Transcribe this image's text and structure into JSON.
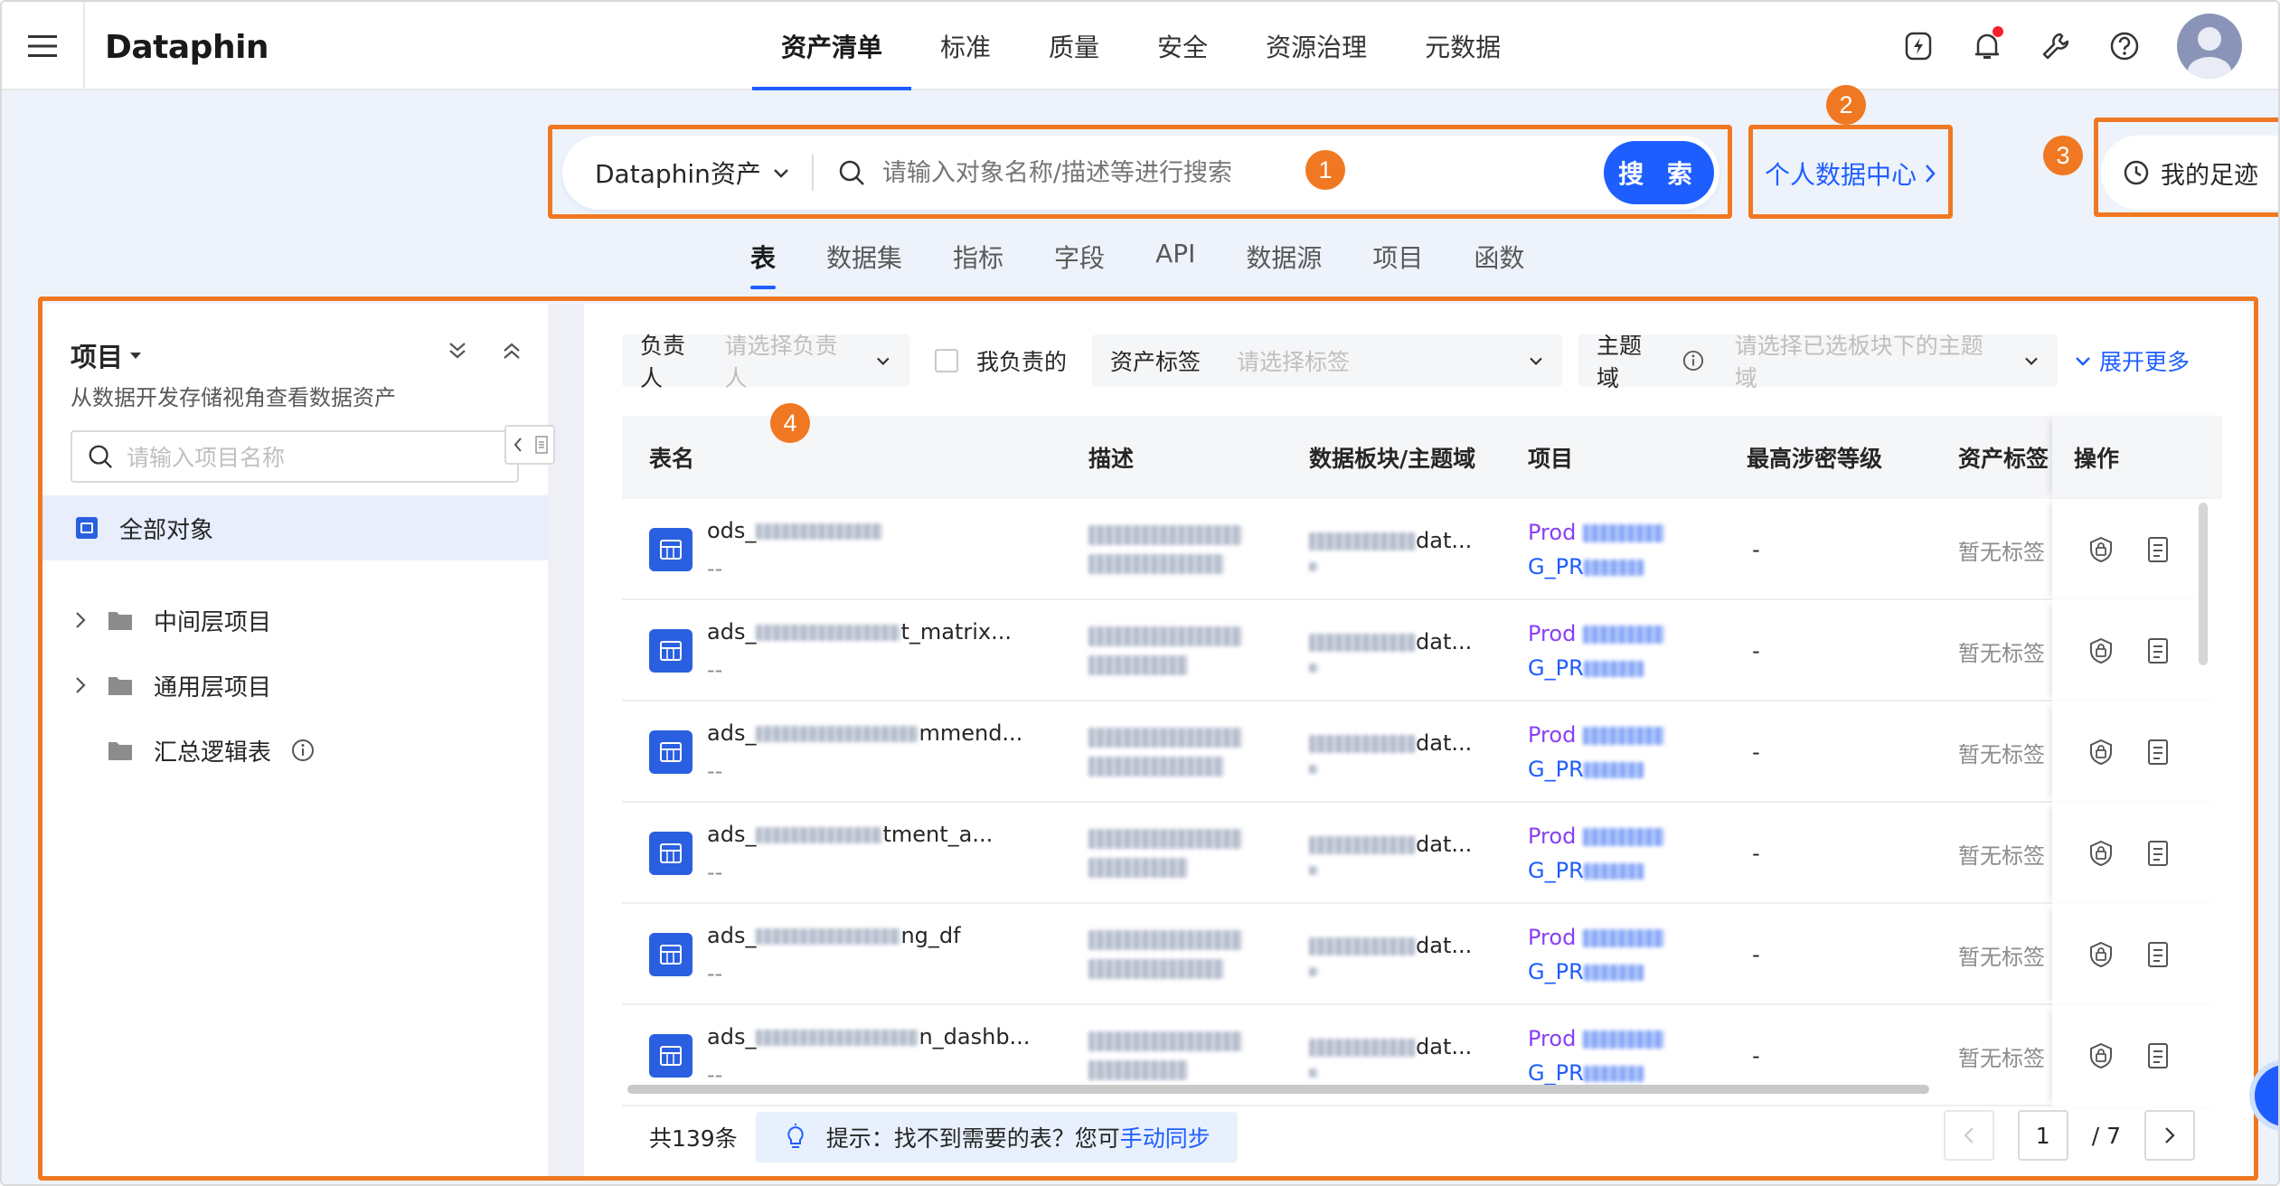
{
  "app": {
    "logo": "Dataphin",
    "nav": [
      "资产清单",
      "标准",
      "质量",
      "安全",
      "资源治理",
      "元数据"
    ],
    "active_nav": 0
  },
  "search": {
    "scope": "Dataphin资产",
    "placeholder": "请输入对象名称/描述等进行搜索",
    "button": "搜 索"
  },
  "personal_center": "个人数据中心",
  "footprint": "我的足迹",
  "badges": [
    "1",
    "2",
    "3",
    "4"
  ],
  "tabs": [
    "表",
    "数据集",
    "指标",
    "字段",
    "API",
    "数据源",
    "项目",
    "函数"
  ],
  "sidebar": {
    "title": "项目",
    "subtitle": "从数据开发存储视角查看数据资产",
    "search_placeholder": "请输入项目名称",
    "all_objects": "全部对象",
    "items": [
      {
        "label": "中间层项目",
        "expandable": true
      },
      {
        "label": "通用层项目",
        "expandable": true
      },
      {
        "label": "汇总逻辑表",
        "expandable": false
      }
    ]
  },
  "filters": {
    "owner_label": "负责人",
    "owner_placeholder": "请选择负责人",
    "mine_label": "我负责的",
    "tag_label": "资产标签",
    "tag_placeholder": "请选择标签",
    "domain_label": "主题域",
    "domain_placeholder": "请选择已选板块下的主题域",
    "expand_more": "展开更多"
  },
  "table": {
    "columns": [
      "表名",
      "描述",
      "数据板块/主题域",
      "项目",
      "最高涉密等级",
      "资产标签",
      "操作"
    ],
    "rows": [
      {
        "name_prefix": "ods_",
        "name_suffix": "",
        "sub": "--",
        "domain": "dat...",
        "project_a": "Prod",
        "project_b": "G_PR",
        "level": "-",
        "tag": "暂无标签"
      },
      {
        "name_prefix": "ads_",
        "name_suffix": "t_matrix...",
        "sub": "--",
        "domain": "dat...",
        "project_a": "Prod",
        "project_b": "G_PR",
        "level": "-",
        "tag": "暂无标签"
      },
      {
        "name_prefix": "ads_",
        "name_suffix": "mmend...",
        "sub": "--",
        "domain": "dat...",
        "project_a": "Prod",
        "project_b": "G_PR",
        "level": "-",
        "tag": "暂无标签"
      },
      {
        "name_prefix": "ads_",
        "name_suffix": "tment_a...",
        "sub": "--",
        "domain": "dat...",
        "project_a": "Prod",
        "project_b": "G_PR",
        "level": "-",
        "tag": "暂无标签"
      },
      {
        "name_prefix": "ads_",
        "name_suffix": "ng_df",
        "sub": "--",
        "domain": "dat...",
        "project_a": "Prod",
        "project_b": "G_PR",
        "level": "-",
        "tag": "暂无标签"
      },
      {
        "name_prefix": "ads_",
        "name_suffix": "n_dashb...",
        "sub": "--",
        "domain": "dat...",
        "project_a": "Prod",
        "project_b": "G_PR",
        "level": "-",
        "tag": "暂无标签"
      }
    ]
  },
  "footer": {
    "total": "共139条",
    "hint_text": "提示：找不到需要的表？您可",
    "hint_link": "手动同步",
    "page_current": "1",
    "page_total": "/ 7"
  },
  "colors": {
    "primary": "#1e5eff",
    "highlight": "#f07822",
    "project_purple": "#8b3ff2"
  }
}
